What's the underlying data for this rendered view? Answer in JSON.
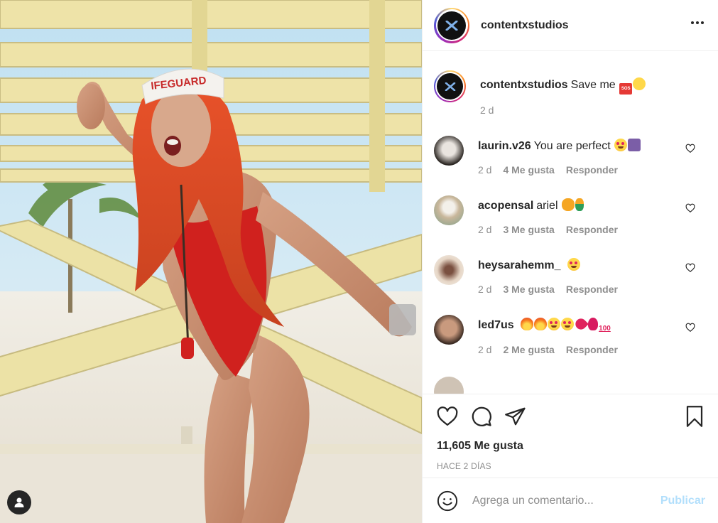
{
  "post": {
    "username": "contentxstudios",
    "more_icon": "more-horizontal-icon",
    "caption": {
      "username": "contentxstudios",
      "text": "Save me",
      "time": "2 d",
      "emojis": [
        "sos-emoji",
        "wink-emoji"
      ]
    },
    "likes": "11,605 Me gusta",
    "posted": "HACE 2 DÍAS"
  },
  "comments": [
    {
      "username": "laurin.v26",
      "text": "You are perfect",
      "time": "2 d",
      "likes": "4 Me gusta",
      "reply": "Responder",
      "emojis": [
        "heart-eyes",
        "purple-emoji"
      ]
    },
    {
      "username": "acopensal",
      "text": "ariel",
      "time": "2 d",
      "likes": "3 Me gusta",
      "reply": "Responder",
      "emojis": [
        "heart-eyes-cat",
        "mermaid"
      ]
    },
    {
      "username": "heysarahemm_",
      "text": "",
      "time": "2 d",
      "likes": "3 Me gusta",
      "reply": "Responder",
      "emojis": [
        "heart-eyes"
      ]
    },
    {
      "username": "led7us",
      "text": "",
      "time": "2 d",
      "likes": "2 Me gusta",
      "reply": "Responder",
      "emojis": [
        "fire",
        "fire",
        "heart-eyes",
        "heart-eyes",
        "heart",
        "rose",
        "hundred"
      ]
    }
  ],
  "comment_box": {
    "placeholder": "Agrega un comentario...",
    "publish": "Publicar"
  },
  "colors": {
    "accent_disabled": "#b2dffc",
    "text": "#262626",
    "muted": "#8e8e8e",
    "border": "#efefef"
  }
}
